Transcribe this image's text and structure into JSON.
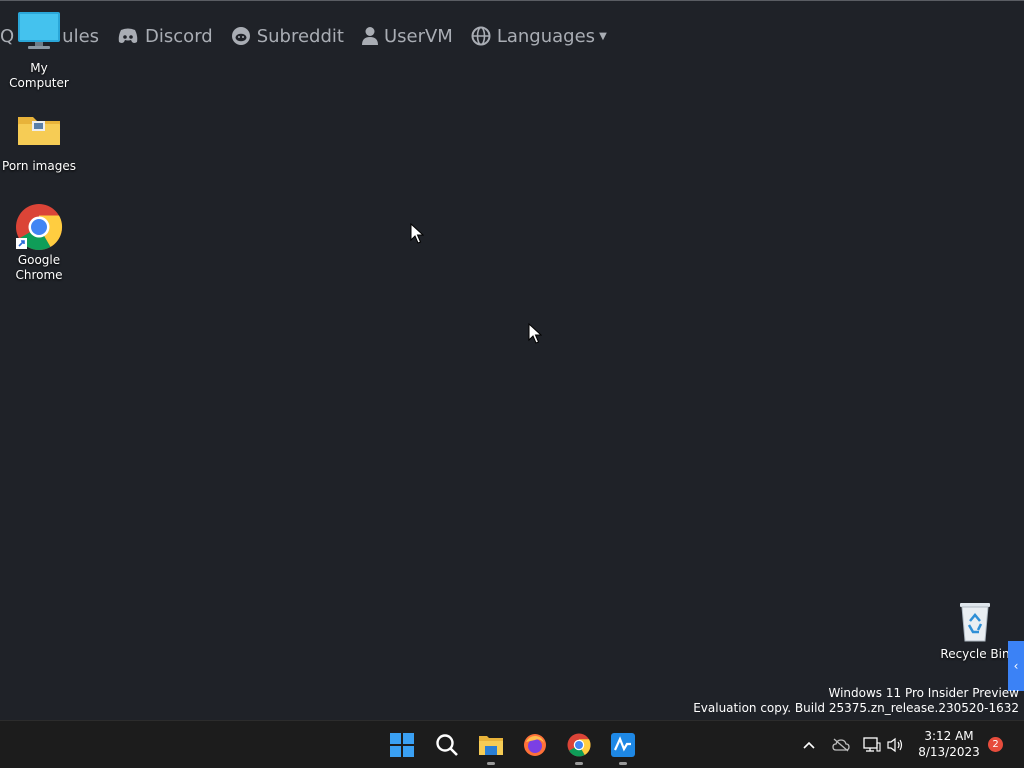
{
  "wallpaper_nav": {
    "partial_item": "ules",
    "items": [
      {
        "label": "Discord",
        "icon": "discord-icon"
      },
      {
        "label": "Subreddit",
        "icon": "reddit-icon"
      },
      {
        "label": "UserVM",
        "icon": "user-icon"
      },
      {
        "label": "Languages",
        "icon": "globe-icon"
      }
    ]
  },
  "desktop_icons": [
    {
      "label": "My Computer",
      "icon": "monitor-icon"
    },
    {
      "label": "Porn images",
      "icon": "folder-icon"
    },
    {
      "label": "Google Chrome",
      "icon": "chrome-icon"
    },
    {
      "label": "Recycle Bin",
      "icon": "recycle-bin-icon"
    }
  ],
  "watermark": {
    "line1": "Windows 11 Pro Insider Preview",
    "line2": "Evaluation copy. Build 25375.zn_release.230520-1632"
  },
  "taskbar": {
    "apps": [
      {
        "name": "Start",
        "icon": "windows-start-icon"
      },
      {
        "name": "Search",
        "icon": "search-icon"
      },
      {
        "name": "File Explorer",
        "icon": "file-explorer-icon"
      },
      {
        "name": "Firefox",
        "icon": "firefox-icon"
      },
      {
        "name": "Google Chrome",
        "icon": "chrome-icon"
      },
      {
        "name": "Activity app",
        "icon": "activity-icon"
      }
    ],
    "tray": {
      "time": "3:12 AM",
      "date": "8/13/2023",
      "notification_count": "2"
    }
  },
  "colors": {
    "desktop_bg": "#1f2228",
    "taskbar_bg": "#1c1c1c",
    "accent": "#3b82f6",
    "badge": "#e74c3c"
  }
}
